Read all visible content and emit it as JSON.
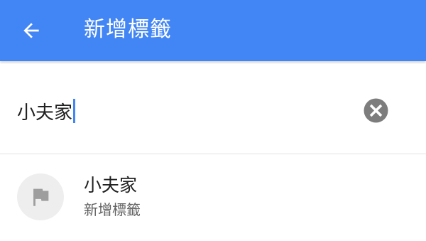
{
  "appbar": {
    "title": "新增標籤",
    "back_icon": "arrow-back-icon",
    "color": "#4285f4"
  },
  "search": {
    "value": "小夫家",
    "clear_icon": "clear-circle-icon",
    "caret_color": "#4285f4"
  },
  "results": [
    {
      "icon": "flag-icon",
      "title": "小夫家",
      "subtitle": "新增標籤"
    }
  ]
}
